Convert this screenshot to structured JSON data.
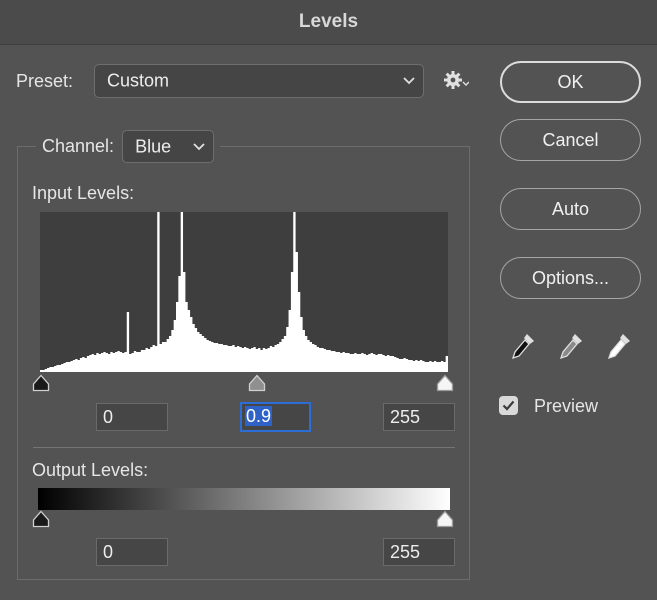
{
  "window": {
    "title": "Levels"
  },
  "preset": {
    "label": "Preset:",
    "value": "Custom"
  },
  "channel": {
    "label": "Channel:",
    "value": "Blue"
  },
  "input_levels": {
    "label": "Input Levels:",
    "black": "0",
    "gamma": "0.9",
    "white": "255",
    "histogram": [
      2,
      2,
      3,
      4,
      5,
      5,
      6,
      7,
      7,
      8,
      9,
      10,
      10,
      11,
      12,
      13,
      12,
      14,
      15,
      14,
      16,
      17,
      18,
      17,
      19,
      18,
      19,
      20,
      19,
      18,
      20,
      19,
      20,
      21,
      20,
      19,
      20,
      60,
      18,
      19,
      21,
      20,
      20,
      22,
      22,
      24,
      23,
      25,
      27,
      26,
      160,
      28,
      30,
      30,
      33,
      36,
      42,
      52,
      70,
      96,
      160,
      100,
      70,
      62,
      55,
      48,
      44,
      40,
      38,
      36,
      34,
      32,
      31,
      30,
      29,
      29,
      28,
      28,
      27,
      27,
      26,
      26,
      27,
      25,
      26,
      25,
      24,
      25,
      24,
      23,
      24,
      25,
      23,
      24,
      22,
      24,
      23,
      24,
      26,
      25,
      27,
      28,
      30,
      33,
      36,
      45,
      62,
      100,
      160,
      120,
      80,
      55,
      42,
      36,
      32,
      30,
      28,
      27,
      25,
      24,
      24,
      23,
      22,
      22,
      21,
      21,
      20,
      20,
      19,
      20,
      19,
      19,
      18,
      18,
      19,
      18,
      18,
      19,
      18,
      17,
      18,
      19,
      18,
      17,
      18,
      18,
      17,
      16,
      17,
      16,
      16,
      15,
      14,
      13,
      13,
      14,
      13,
      12,
      12,
      11,
      12,
      11,
      12,
      11,
      10,
      10,
      11,
      10,
      11,
      10,
      10,
      11,
      10,
      16
    ]
  },
  "output_levels": {
    "label": "Output Levels:",
    "black": "0",
    "white": "255"
  },
  "buttons": {
    "ok": "OK",
    "cancel": "Cancel",
    "auto": "Auto",
    "options": "Options..."
  },
  "preview": {
    "label": "Preview",
    "checked": true
  },
  "icons": {
    "preset_chevron": "chevron-down-icon",
    "gear": "gear-icon",
    "droppers": [
      "black-point-eyedropper-icon",
      "gray-point-eyedropper-icon",
      "white-point-eyedropper-icon"
    ]
  }
}
